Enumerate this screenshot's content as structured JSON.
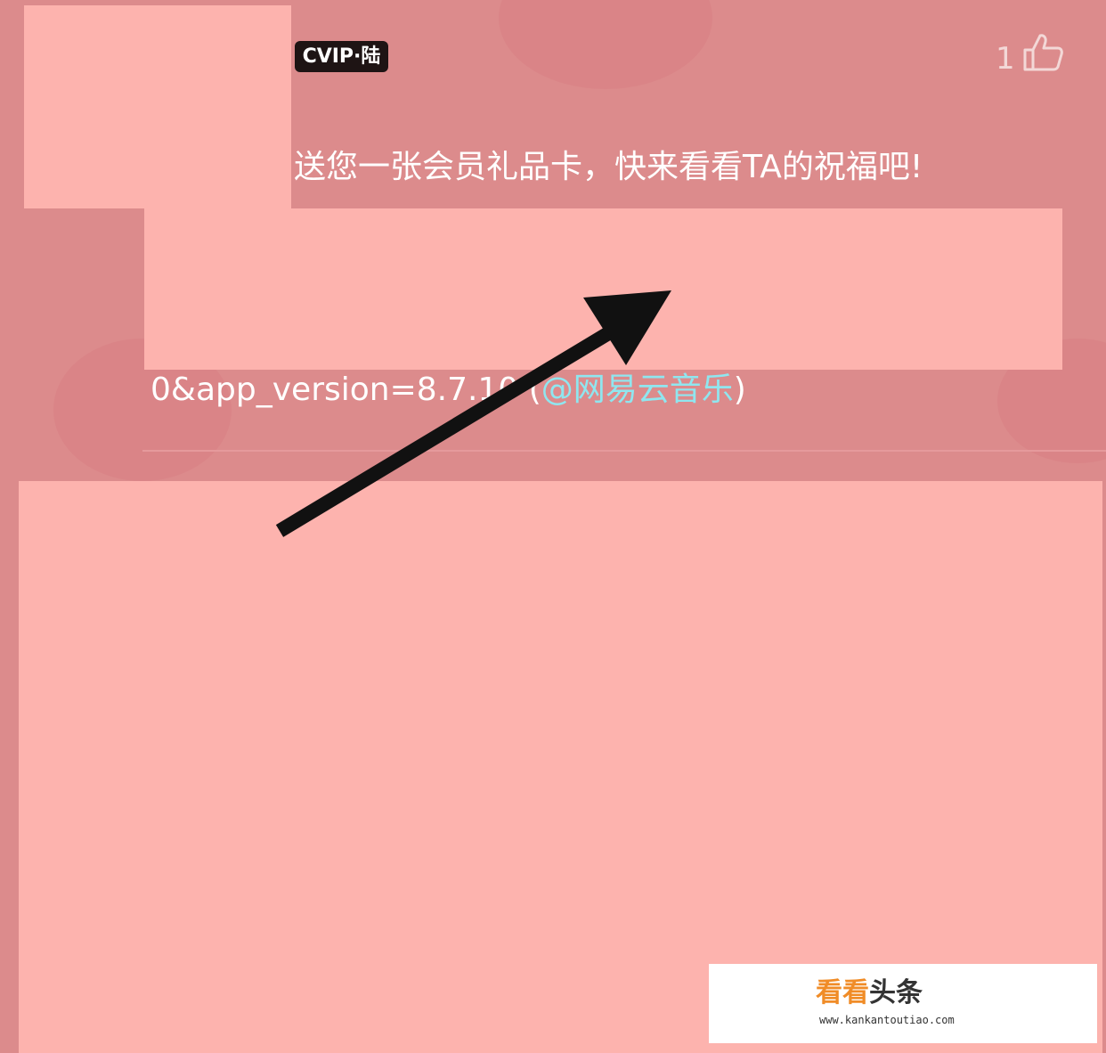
{
  "comment": {
    "vip_badge": "CVIP·陆",
    "like_count": "1",
    "like_icon": "thumbs-up-icon",
    "text": "送您一张会员礼品卡，快来看看TA的祝福吧!",
    "link_tail": "0&app_version=8.7.10 (",
    "mention": "@网易云音乐",
    "closing": ")"
  },
  "watermark": {
    "brand_part1": "看看",
    "brand_part2": "头条",
    "url": "www.kankantoutiao.com"
  },
  "colors": {
    "background": "#dc8b8c",
    "redaction": "#fdb3ae",
    "mention": "#8fe6ef",
    "arrow": "#111111",
    "watermark_accent": "#f08c27"
  }
}
